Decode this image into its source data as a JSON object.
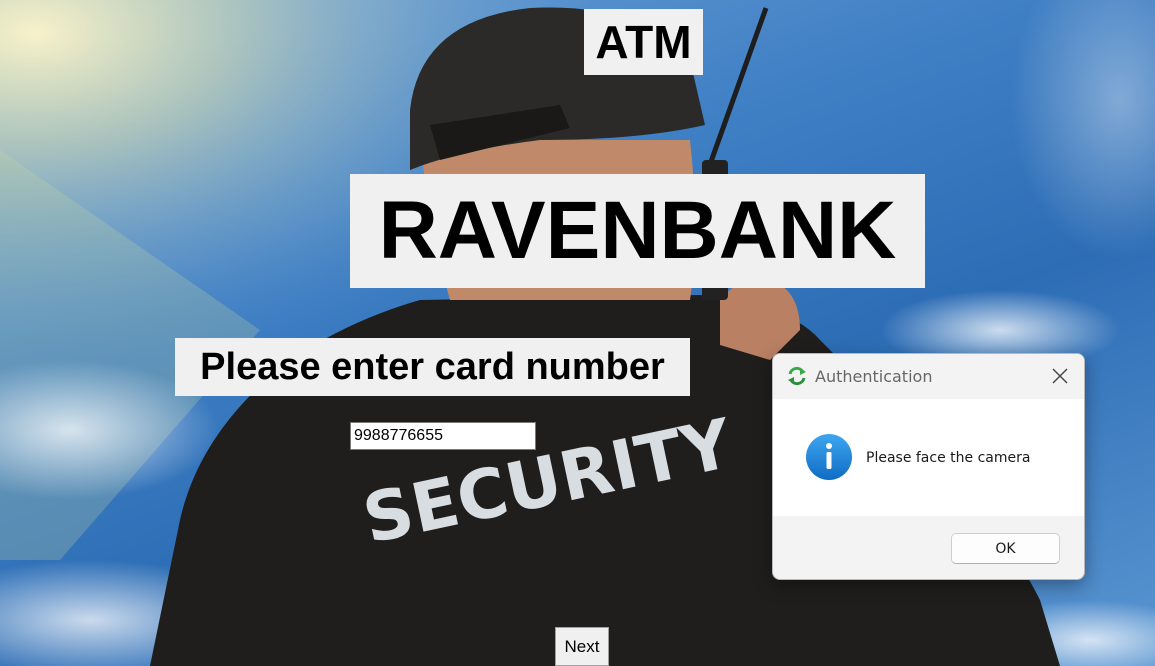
{
  "atm": {
    "heading": "ATM",
    "bank_name": "RAVENBANK",
    "prompt": "Please enter card number",
    "card_number_value": "9988776655",
    "next_label": "Next",
    "background_text": "SECURITY"
  },
  "dialog": {
    "title": "Authentication",
    "message": "Please face the camera",
    "ok_label": "OK",
    "icons": {
      "app": "refresh-arrows-icon",
      "message": "info-icon",
      "close": "close-icon"
    }
  },
  "colors": {
    "sky": "#3f7fc4",
    "label_bg": "#f0f0f0",
    "info_blue": "#1a7fd4",
    "app_icon_green": "#3aa84a"
  }
}
